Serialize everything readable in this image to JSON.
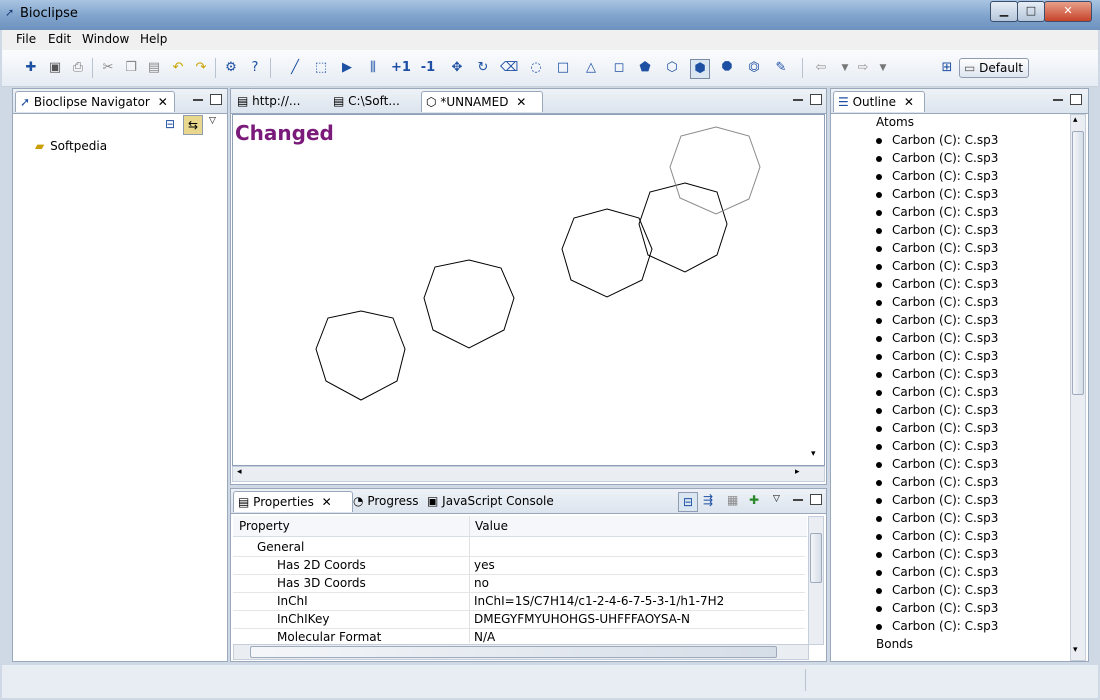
{
  "window": {
    "title": "Bioclipse",
    "buttons": {
      "minimize": "▁",
      "maximize": "□",
      "close": "✕"
    }
  },
  "menubar": [
    "File",
    "Edit",
    "Window",
    "Help"
  ],
  "toolbar": {
    "perspective_label": "Default"
  },
  "navigator": {
    "title": "Bioclipse Navigator",
    "items": [
      {
        "label": "Softpedia"
      }
    ]
  },
  "editor": {
    "tabs": [
      {
        "label": "http://..."
      },
      {
        "label": "C:\\Soft..."
      },
      {
        "label": "*UNNAMED"
      }
    ],
    "status_text": "Changed"
  },
  "outline": {
    "title": "Outline",
    "sections": {
      "atoms": "Atoms",
      "bonds": "Bonds"
    },
    "atom_label": "Carbon (C): C.sp3",
    "atom_count": 28
  },
  "properties": {
    "tabs": [
      {
        "label": "Properties"
      },
      {
        "label": "Progress"
      },
      {
        "label": "JavaScript Console"
      }
    ],
    "headers": {
      "property": "Property",
      "value": "Value"
    },
    "group": "General",
    "rows": [
      {
        "key": "Has 2D Coords",
        "value": "yes"
      },
      {
        "key": "Has 3D Coords",
        "value": "no"
      },
      {
        "key": "InChI",
        "value": "InChI=1S/C7H14/c1-2-4-6-7-5-3-1/h1-7H2"
      },
      {
        "key": "InChIKey",
        "value": "DMEGYFMYUHOHGS-UHFFFAOYSA-N"
      },
      {
        "key": "Molecular Format",
        "value": "N/A"
      }
    ]
  },
  "colors": {
    "changed": "#7a1a7a",
    "accent": "#1d4fa3"
  }
}
